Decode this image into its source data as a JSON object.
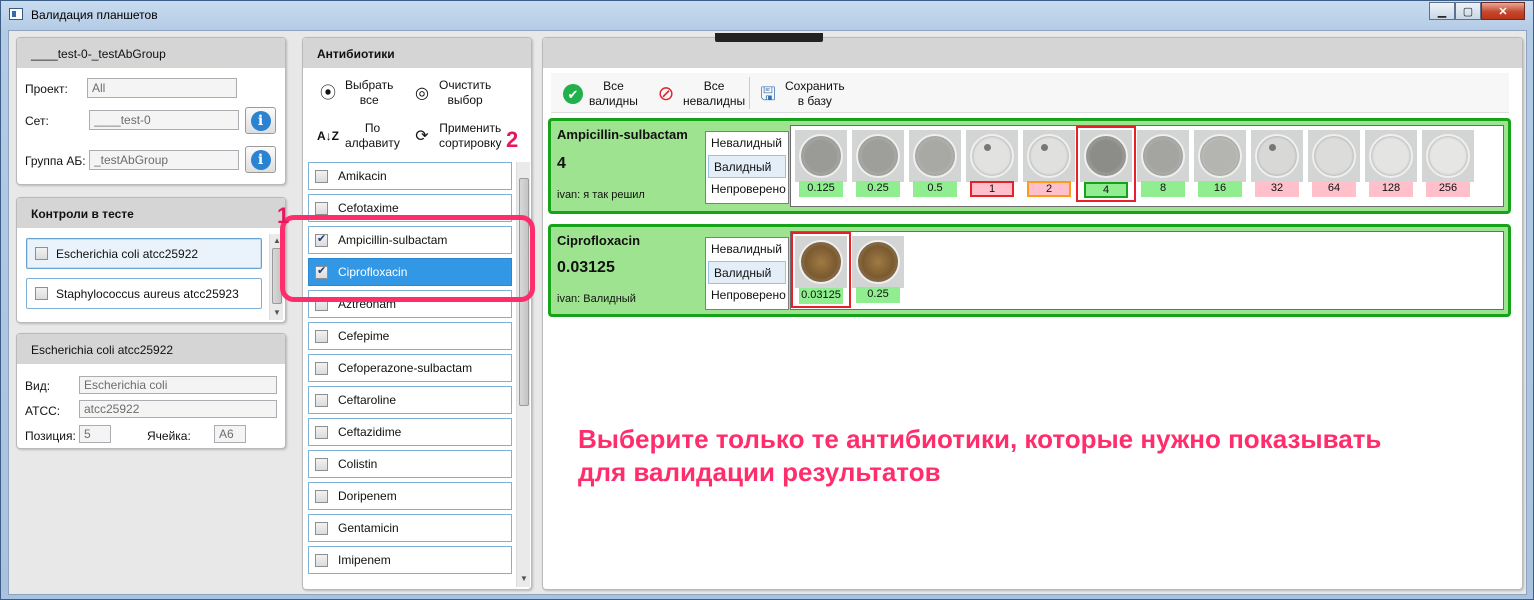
{
  "window": {
    "title": "Валидация планшетов"
  },
  "test_panel": {
    "title": "____test-0-_testAbGroup",
    "project_label": "Проект:",
    "project_value": "All",
    "set_label": "Сет:",
    "set_value": "____test-0",
    "group_label": "Группа АБ:",
    "group_value": "_testAbGroup"
  },
  "controls_panel": {
    "title": "Контроли в тесте",
    "items": [
      "Escherichia coli atcc25922",
      "Staphylococcus aureus atcc25923"
    ]
  },
  "details_panel": {
    "title": "Escherichia coli atcc25922",
    "species_label": "Вид:",
    "species_value": "Escherichia coli",
    "atcc_label": "ATCC:",
    "atcc_value": "atcc25922",
    "position_label": "Позиция:",
    "position_value": "5",
    "cell_label": "Ячейка:",
    "cell_value": "A6"
  },
  "antibiotics_panel": {
    "title": "Антибиотики",
    "select_all": "Выбрать\nвсе",
    "clear": "Очистить\nвыбор",
    "alpha": "По\nалфавиту",
    "apply_sort": "Применить\nсортировку",
    "items": [
      {
        "name": "Amikacin",
        "checked": false
      },
      {
        "name": "Cefotaxime",
        "checked": false
      },
      {
        "name": "Ampicillin-sulbactam",
        "checked": true
      },
      {
        "name": "Ciprofloxacin",
        "checked": true
      },
      {
        "name": "Aztreonam",
        "checked": false
      },
      {
        "name": "Cefepime",
        "checked": false
      },
      {
        "name": "Cefoperazone-sulbactam",
        "checked": false
      },
      {
        "name": "Ceftaroline",
        "checked": false
      },
      {
        "name": "Ceftazidime",
        "checked": false
      },
      {
        "name": "Colistin",
        "checked": false
      },
      {
        "name": "Doripenem",
        "checked": false
      },
      {
        "name": "Gentamicin",
        "checked": false
      },
      {
        "name": "Imipenem",
        "checked": false
      }
    ]
  },
  "toolbar": {
    "all_valid": "Все\nвалидны",
    "all_invalid": "Все\nневалидны",
    "save": "Сохранить\nв базу"
  },
  "results": [
    {
      "antibiotic": "Ampicillin-sulbactam",
      "mic": "4",
      "comment": "ivan:  я так решил",
      "statuses": [
        "Невалидный",
        "Валидный",
        "Непроверено"
      ],
      "wells": [
        "0.125",
        "0.25",
        "0.5",
        "1",
        "2",
        "4",
        "8",
        "16",
        "32",
        "64",
        "128",
        "256"
      ]
    },
    {
      "antibiotic": "Ciprofloxacin",
      "mic": "0.03125",
      "comment": "ivan:  Валидный",
      "statuses": [
        "Невалидный",
        "Валидный",
        "Непроверено"
      ],
      "wells": [
        "0.03125",
        "0.25"
      ]
    }
  ],
  "annotations": {
    "step1": "1",
    "step2": "2",
    "instruction_line1": "Выберите только те антибиотики, которые нужно показывать",
    "instruction_line2": "для валидации результатов"
  },
  "colors": {
    "valid_green": "#90ee90",
    "invalid_pink": "#ffc0cb",
    "selection_blue": "#3297e5",
    "callout": "#ff2d6b"
  }
}
